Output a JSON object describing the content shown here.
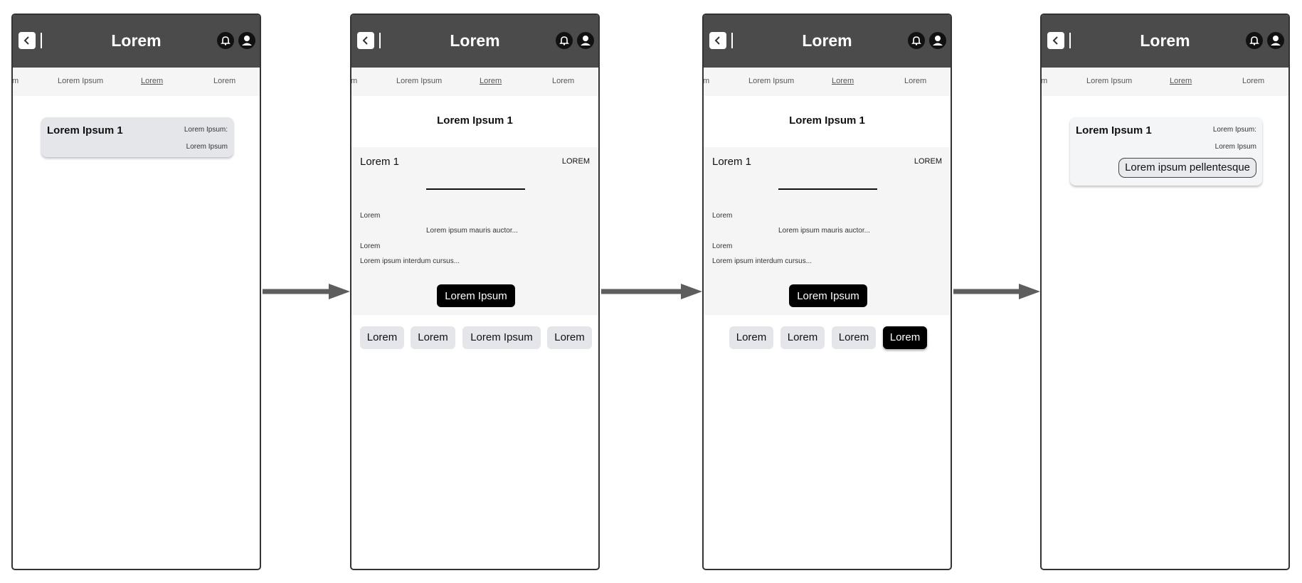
{
  "header": {
    "title": "Lorem"
  },
  "tabs": [
    "m",
    "Lorem Ipsum",
    "Lorem",
    "Lorem"
  ],
  "summary": {
    "title": "Lorem Ipsum 1",
    "label": "Lorem Ipsum:",
    "value": "Lorem Ipsum",
    "tag": "Lorem ipsum pellentesque"
  },
  "detail": {
    "title": "Lorem Ipsum 1",
    "name": "Lorem 1",
    "tag": "LOREM",
    "row1_label": "Lorem",
    "row1_value": "Lorem ipsum mauris auctor...",
    "row2_label": "Lorem",
    "row2_value": "Lorem ipsum interdum cursus...",
    "button": "Lorem Ipsum"
  },
  "chips_screen2": [
    "Lorem",
    "Lorem",
    "Lorem Ipsum",
    "Lorem"
  ],
  "chips_screen3": [
    "Lorem",
    "Lorem",
    "Lorem",
    "Lorem"
  ],
  "chips_screen3_selected": 3,
  "colors": {
    "appbar": "#4b4b4b",
    "chip": "#e4e6ea",
    "panel": "#f4f5f4",
    "arrow": "#5e5e5e"
  }
}
